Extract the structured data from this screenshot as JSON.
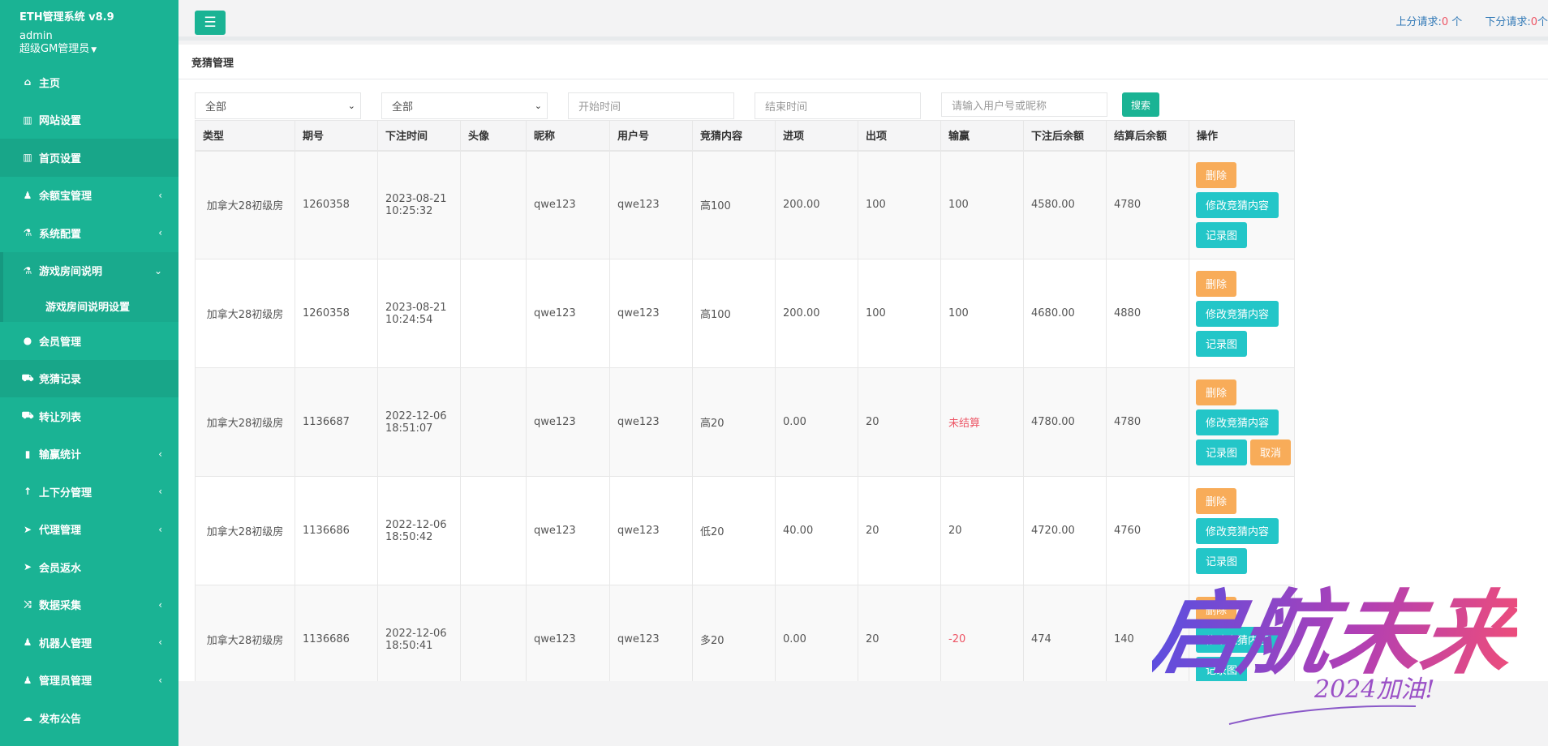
{
  "sidebar": {
    "system_name": "ETH管理系统 v8.9",
    "username": "admin",
    "role": "超级GM管理员",
    "items": [
      {
        "label": "主页",
        "icon": "home-icon"
      },
      {
        "label": "网站设置",
        "icon": "columns-icon"
      },
      {
        "label": "首页设置",
        "icon": "columns-icon"
      },
      {
        "label": "余额宝管理",
        "icon": "male-icon"
      },
      {
        "label": "系统配置",
        "icon": "flask-icon"
      },
      {
        "label": "游戏房间说明",
        "icon": "flask-icon"
      },
      {
        "label": "游戏房间说明设置"
      },
      {
        "label": "会员管理",
        "icon": "user-icon"
      },
      {
        "label": "竞猜记录",
        "icon": "cab-icon"
      },
      {
        "label": "转让列表",
        "icon": "cab-icon"
      },
      {
        "label": "输赢统计",
        "icon": "bar-chart-icon"
      },
      {
        "label": "上下分管理",
        "icon": "level-up-icon"
      },
      {
        "label": "代理管理",
        "icon": "paper-plane-icon"
      },
      {
        "label": "会员返水",
        "icon": "paper-plane-icon"
      },
      {
        "label": "数据采集",
        "icon": "random-icon"
      },
      {
        "label": "机器人管理",
        "icon": "male-icon"
      },
      {
        "label": "管理员管理",
        "icon": "male-icon"
      },
      {
        "label": "发布公告",
        "icon": "comment-icon"
      }
    ]
  },
  "topbar": {
    "up_label": "上分请求:",
    "up_count": "0",
    "up_unit": "个",
    "down_label": "下分请求:",
    "down_count": "0",
    "down_unit": "个"
  },
  "page": {
    "title": "竞猜管理"
  },
  "filters": {
    "select1": "全部",
    "select2": "全部",
    "start_placeholder": "开始时间",
    "end_placeholder": "结束时间",
    "user_placeholder": "请输入用户号或昵称",
    "search_label": "搜索"
  },
  "table": {
    "headers": [
      "类型",
      "期号",
      "下注时间",
      "头像",
      "昵称",
      "用户号",
      "竞猜内容",
      "进项",
      "出项",
      "输赢",
      "下注后余额",
      "结算后余额",
      "操作"
    ],
    "actions": {
      "delete": "删除",
      "edit": "修改竞猜内容",
      "record": "记录图",
      "cancel": "取消"
    },
    "rows": [
      {
        "type": "加拿大28初级房",
        "period": "1260358",
        "date": "2023-08-21",
        "time": "10:25:32",
        "nickname": "qwe123",
        "userid": "qwe123",
        "content": "高100",
        "in": "200.00",
        "out": "100",
        "result": "100",
        "bal_before": "4580.00",
        "bal_after": "4780"
      },
      {
        "type": "加拿大28初级房",
        "period": "1260358",
        "date": "2023-08-21",
        "time": "10:24:54",
        "nickname": "qwe123",
        "userid": "qwe123",
        "content": "高100",
        "in": "200.00",
        "out": "100",
        "result": "100",
        "bal_before": "4680.00",
        "bal_after": "4880"
      },
      {
        "type": "加拿大28初级房",
        "period": "1136687",
        "date": "2022-12-06",
        "time": "18:51:07",
        "nickname": "qwe123",
        "userid": "qwe123",
        "content": "高20",
        "in": "0.00",
        "out": "20",
        "result": "未结算",
        "bal_before": "4780.00",
        "bal_after": "4780"
      },
      {
        "type": "加拿大28初级房",
        "period": "1136686",
        "date": "2022-12-06",
        "time": "18:50:42",
        "nickname": "qwe123",
        "userid": "qwe123",
        "content": "低20",
        "in": "40.00",
        "out": "20",
        "result": "20",
        "bal_before": "4720.00",
        "bal_after": "4760"
      },
      {
        "type": "加拿大28初级房",
        "period": "1136686",
        "date": "2022-12-06",
        "time": "18:50:41",
        "nickname": "qwe123",
        "userid": "qwe123",
        "content": "多20",
        "in": "0.00",
        "out": "20",
        "result": "-20",
        "bal_before": "474",
        "bal_after": "140"
      }
    ]
  },
  "watermark": {
    "text": "启航未来",
    "sub": "2024加油!"
  },
  "colors": {
    "primary": "#1ab394",
    "warning": "#f8ac59",
    "info": "#23c6c8",
    "danger": "#ed5565"
  }
}
